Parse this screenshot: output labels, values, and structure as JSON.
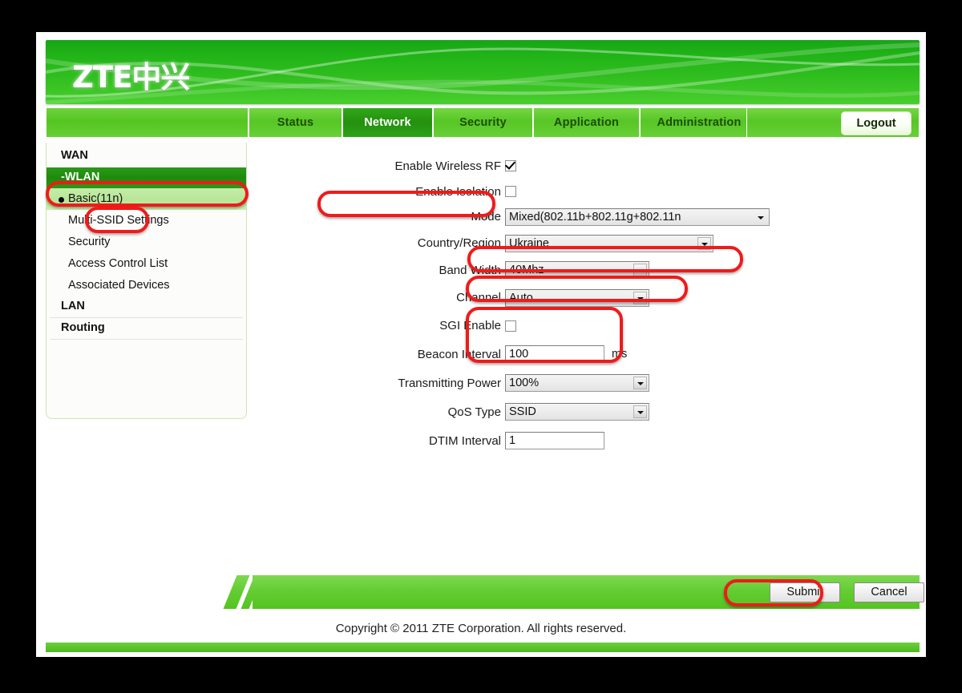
{
  "brand": {
    "logo_text": "ZTE中兴"
  },
  "nav": {
    "tabs": [
      {
        "label": "Status",
        "active": false
      },
      {
        "label": "Network",
        "active": true
      },
      {
        "label": "Security",
        "active": false
      },
      {
        "label": "Application",
        "active": false
      },
      {
        "label": "Administration",
        "active": false
      }
    ],
    "logout_label": "Logout"
  },
  "sidebar": {
    "groups": [
      {
        "label": "WAN",
        "selected": false
      },
      {
        "label": "-WLAN",
        "selected": true
      }
    ],
    "items": [
      {
        "label": "Basic(11n)",
        "active": true
      },
      {
        "label": "Multi-SSID Settings",
        "active": false
      },
      {
        "label": "Security",
        "active": false
      },
      {
        "label": "Access Control List",
        "active": false
      },
      {
        "label": "Associated Devices",
        "active": false
      }
    ],
    "groups_bottom": [
      {
        "label": "LAN"
      },
      {
        "label": "Routing"
      }
    ]
  },
  "form": {
    "enable_wireless_rf": {
      "label": "Enable Wireless RF",
      "checked": true
    },
    "enable_isolation": {
      "label": "Enable Isolation",
      "checked": false
    },
    "mode": {
      "label": "Mode",
      "value": "Mixed(802.11b+802.11g+802.11n"
    },
    "country_region": {
      "label": "Country/Region",
      "value": "Ukraine"
    },
    "band_width": {
      "label": "Band Width",
      "value": "40Mhz"
    },
    "channel": {
      "label": "Channel",
      "value": "Auto"
    },
    "sgi_enable": {
      "label": "SGI Enable",
      "checked": false
    },
    "beacon_interval": {
      "label": "Beacon Interval",
      "value": "100",
      "unit": "ms"
    },
    "transmitting_power": {
      "label": "Transmitting Power",
      "value": "100%"
    },
    "qos_type": {
      "label": "QoS Type",
      "value": "SSID"
    },
    "dtim_interval": {
      "label": "DTIM Interval",
      "value": "1"
    }
  },
  "actions": {
    "submit_label": "Submit",
    "cancel_label": "Cancel"
  },
  "footer": {
    "copyright": "Copyright © 2011 ZTE Corporation. All rights reserved."
  },
  "colors": {
    "brand_green": "#2fbd1e",
    "tab_green": "#57c626",
    "tab_active_green": "#24900f",
    "sidebar_selected_green": "#1e8a0d",
    "sidebar_item_active_green": "#b6e697",
    "annotation_red": "#f01a1a"
  }
}
